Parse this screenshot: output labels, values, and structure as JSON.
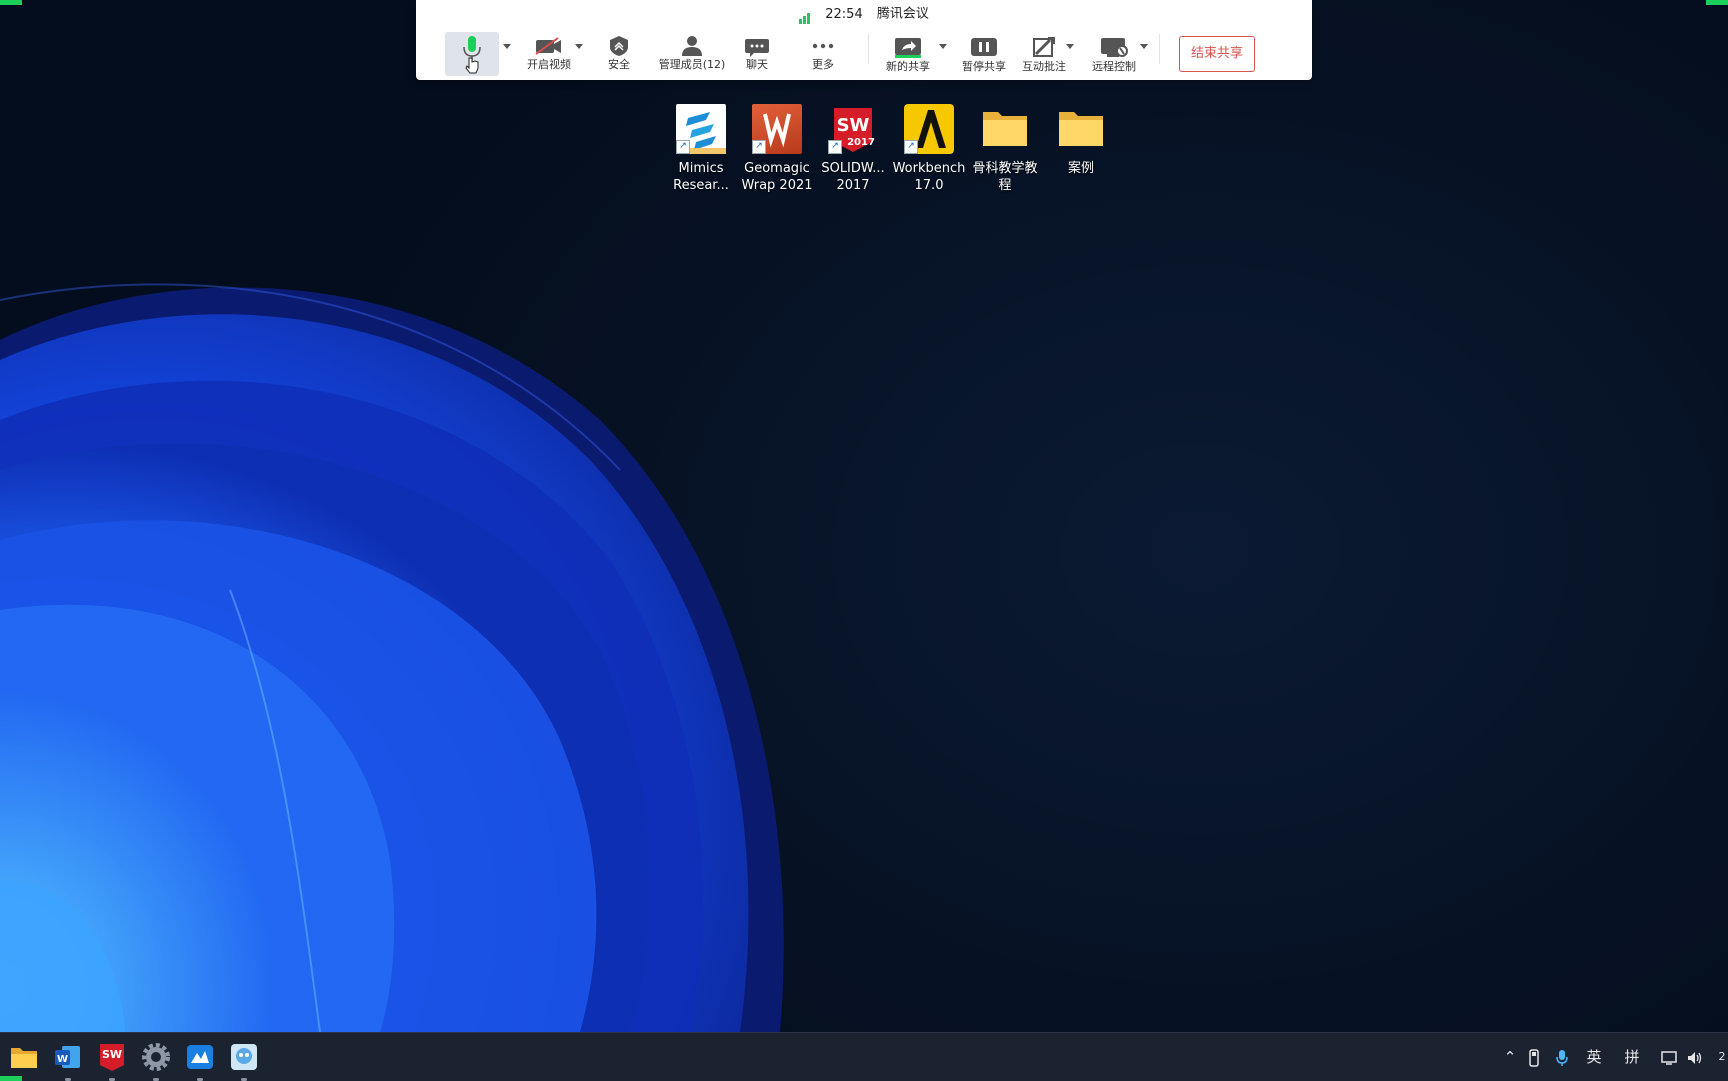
{
  "meeting_bar": {
    "time": "22:54",
    "app_name": "腾讯会议",
    "buttons": {
      "video": "开启视频",
      "security": "安全",
      "members": "管理成员(12)",
      "chat": "聊天",
      "more": "更多",
      "new_share": "新的共享",
      "pause_share": "暂停共享",
      "annotate": "互动批注",
      "remote_control": "远程控制",
      "end_share": "结束共享"
    },
    "colors": {
      "accent_green": "#1ccf5b",
      "end_share_red": "#d9534f"
    }
  },
  "desktop": {
    "icons": [
      {
        "line1": "Mimics",
        "line2": "Resear...",
        "icon": "mimics-icon"
      },
      {
        "line1": "Geomagic",
        "line2": "Wrap 2021",
        "icon": "geomagic-icon"
      },
      {
        "line1": "SOLIDW...",
        "line2": "2017",
        "icon": "solidworks-icon"
      },
      {
        "line1": "Workbench",
        "line2": "17.0",
        "icon": "workbench-icon"
      },
      {
        "line1": "骨科教学教程",
        "line2": "",
        "icon": "folder-icon"
      },
      {
        "line1": "案例",
        "line2": "",
        "icon": "folder-icon"
      }
    ]
  },
  "taskbar": {
    "apps": [
      "file-explorer-icon",
      "word-icon",
      "solidworks-icon",
      "settings-icon",
      "mimics-icon",
      "tencent-meeting-icon"
    ],
    "tray": {
      "lang": "英",
      "ime": "拼",
      "clock_partial": "2"
    }
  }
}
